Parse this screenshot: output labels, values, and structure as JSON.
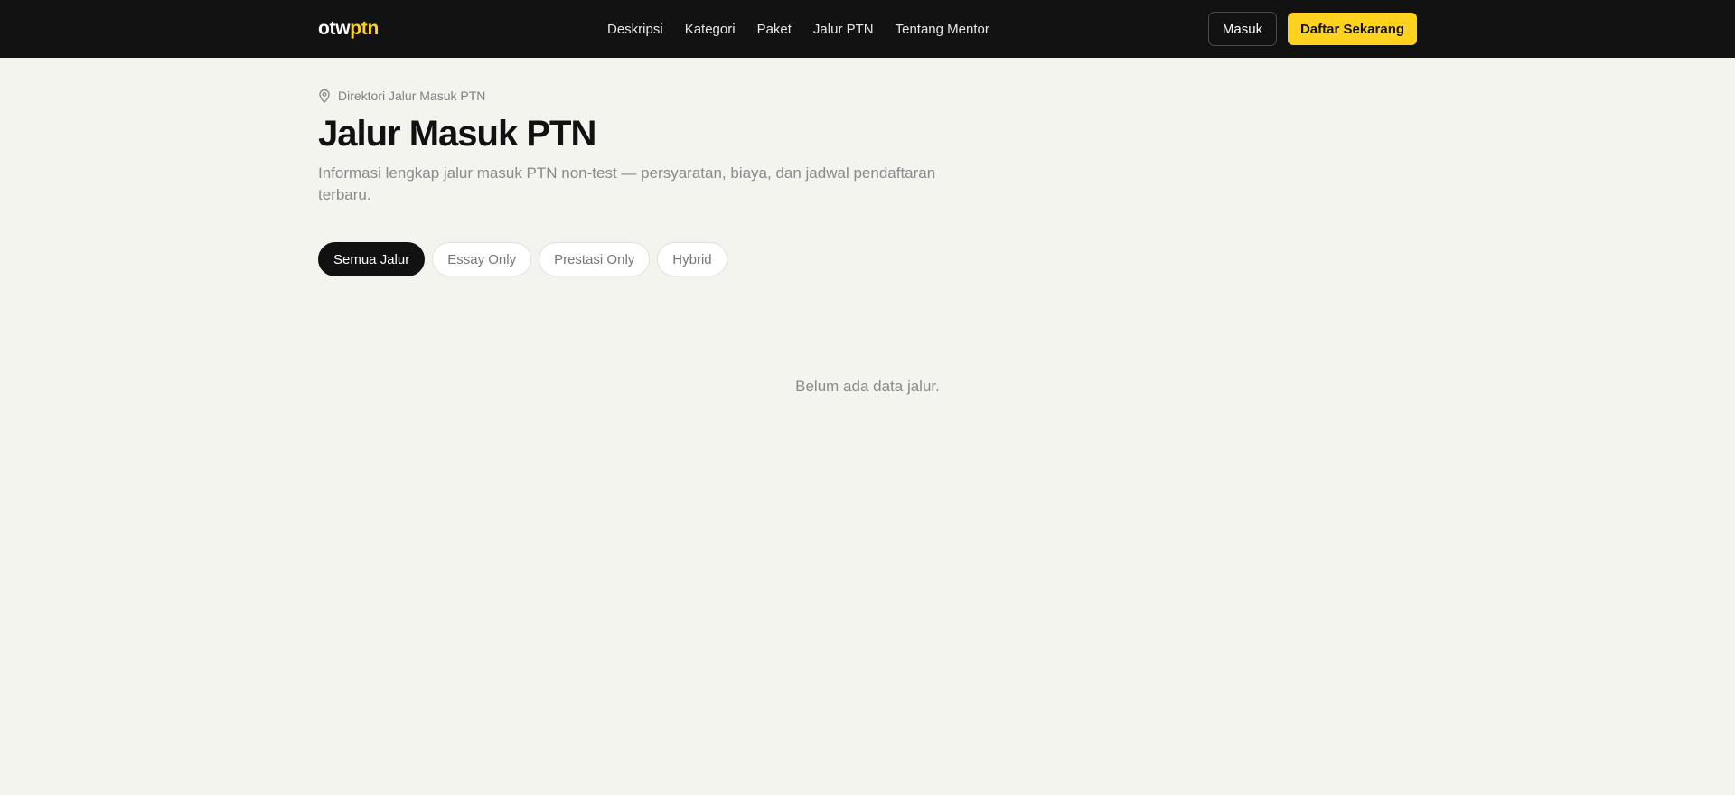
{
  "header": {
    "logo": {
      "part1": "otw",
      "part2": "ptn"
    },
    "nav": [
      {
        "label": "Deskripsi"
      },
      {
        "label": "Kategori"
      },
      {
        "label": "Paket"
      },
      {
        "label": "Jalur PTN"
      },
      {
        "label": "Tentang Mentor"
      }
    ],
    "login_label": "Masuk",
    "register_label": "Daftar Sekarang"
  },
  "breadcrumb": {
    "label": "Direktori Jalur Masuk PTN",
    "icon": "map-pin-icon"
  },
  "page": {
    "title": "Jalur Masuk PTN",
    "subtitle": "Informasi lengkap jalur masuk PTN non-test — persyaratan, biaya, dan jadwal pendaftaran terbaru."
  },
  "filters": [
    {
      "label": "Semua Jalur",
      "active": true
    },
    {
      "label": "Essay Only",
      "active": false
    },
    {
      "label": "Prestasi Only",
      "active": false
    },
    {
      "label": "Hybrid",
      "active": false
    }
  ],
  "empty_state": "Belum ada data jalur.",
  "colors": {
    "header_bg": "#121212",
    "accent": "#ffd21f",
    "page_bg": "#f4f4ef",
    "active_chip": "#111111"
  }
}
